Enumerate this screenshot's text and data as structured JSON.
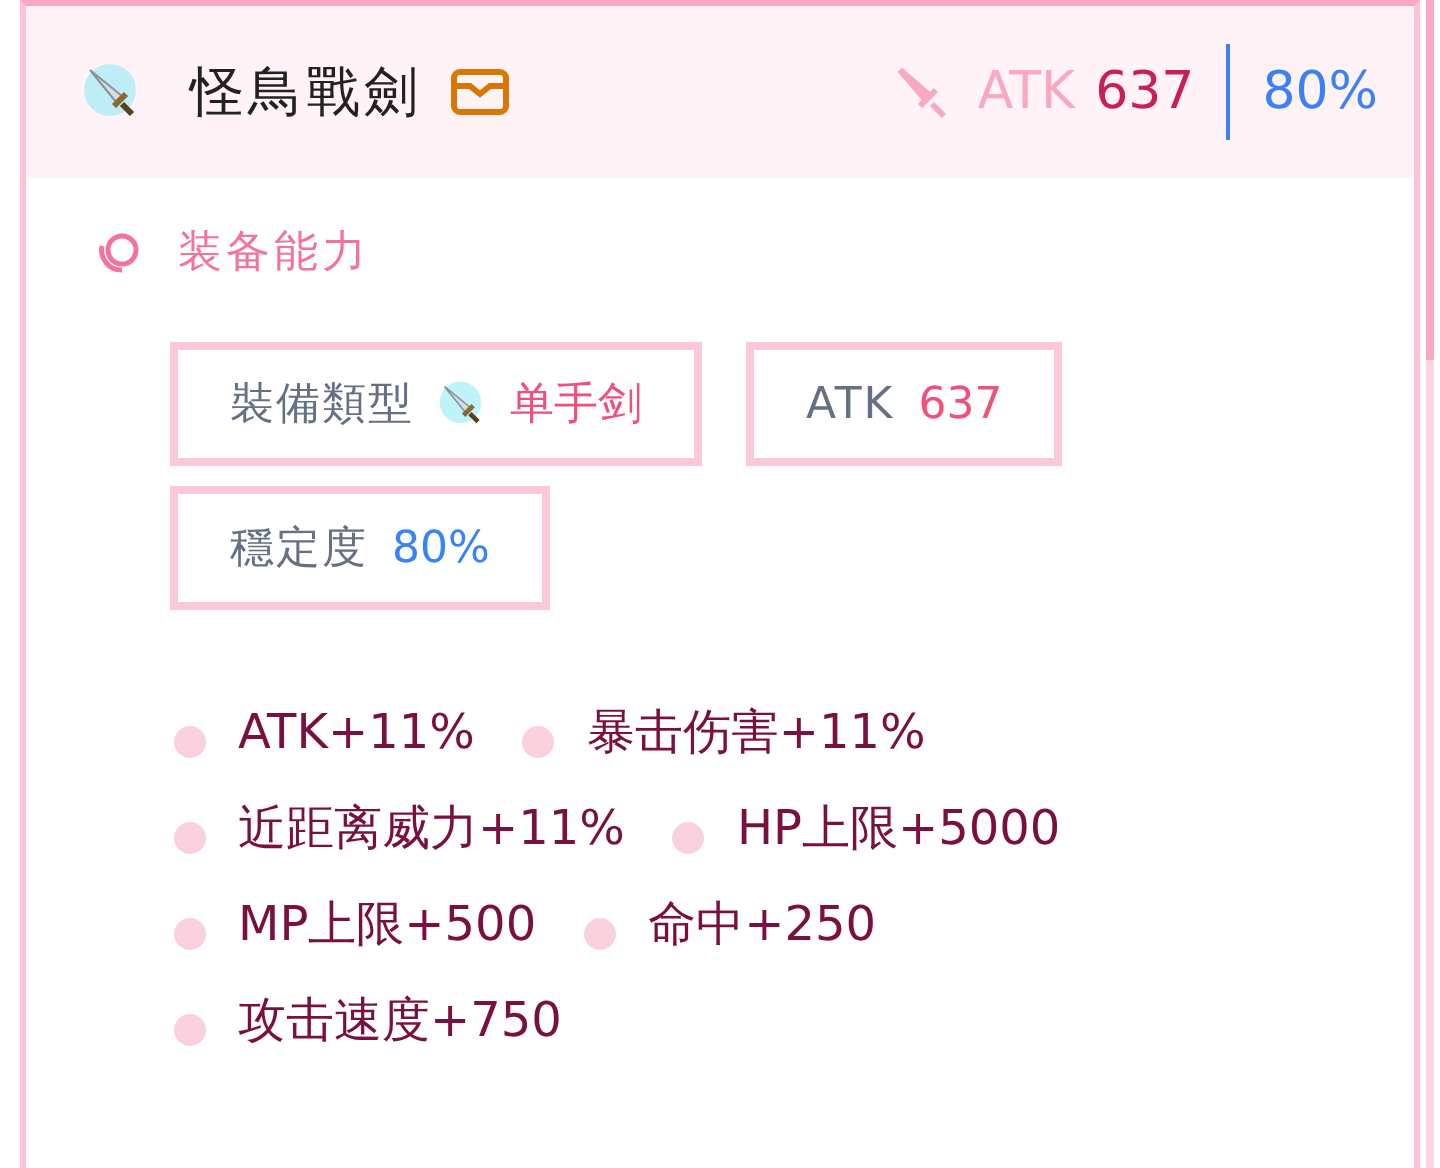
{
  "header": {
    "title": "怪鳥戰劍",
    "atk_label": "ATK",
    "atk_value": "637",
    "stability": "80%"
  },
  "section": {
    "title": "装备能力"
  },
  "chips": [
    {
      "kind": "type",
      "label": "裝備類型",
      "value": "单手剑"
    },
    {
      "kind": "atk",
      "label": "ATK",
      "value": "637"
    },
    {
      "kind": "stability",
      "label": "穩定度",
      "value": "80%"
    }
  ],
  "stats": [
    "ATK+11%",
    "暴击伤害+11%",
    "近距离威力+11%",
    "HP上限+5000",
    "MP上限+500",
    "命中+250",
    "攻击速度+750"
  ]
}
